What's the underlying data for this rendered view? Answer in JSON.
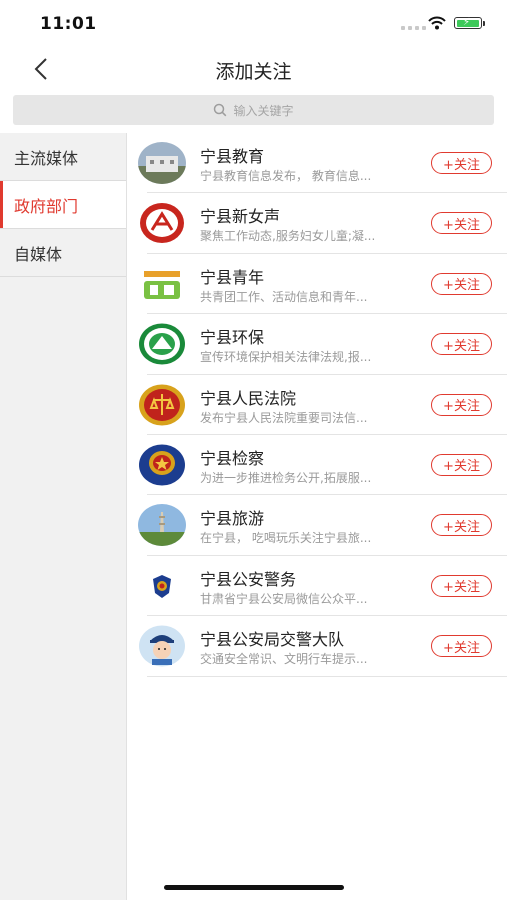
{
  "status_bar": {
    "time": "11:01"
  },
  "header": {
    "title": "添加关注",
    "back_icon": "chevron-left-icon"
  },
  "search": {
    "placeholder": "输入关键字",
    "icon": "search-icon"
  },
  "sidebar": {
    "items": [
      {
        "label": "主流媒体",
        "active": false
      },
      {
        "label": "政府部门",
        "active": true
      },
      {
        "label": "自媒体",
        "active": false
      }
    ]
  },
  "accounts": [
    {
      "name": "宁县教育",
      "desc": "宁县教育信息发布， 教育信息...",
      "follow": "+关注",
      "icon": "school-photo-icon"
    },
    {
      "name": "宁县新女声",
      "desc": "聚焦工作动态,服务妇女儿童;凝...",
      "follow": "+关注",
      "icon": "women-federation-icon"
    },
    {
      "name": "宁县青年",
      "desc": "共青团工作、活动信息和青年...",
      "follow": "+关注",
      "icon": "youth-logo-icon"
    },
    {
      "name": "宁县环保",
      "desc": "宣传环境保护相关法律法规,报...",
      "follow": "+关注",
      "icon": "environment-emblem-icon"
    },
    {
      "name": "宁县人民法院",
      "desc": "发布宁县人民法院重要司法信...",
      "follow": "+关注",
      "icon": "court-emblem-icon"
    },
    {
      "name": "宁县检察",
      "desc": "为进一步推进检务公开,拓展服...",
      "follow": "+关注",
      "icon": "procuratorate-emblem-icon"
    },
    {
      "name": "宁县旅游",
      "desc": "在宁县， 吃喝玩乐关注宁县旅...",
      "follow": "+关注",
      "icon": "tower-photo-icon"
    },
    {
      "name": "宁县公安警务",
      "desc": "甘肃省宁县公安局微信公众平...",
      "follow": "+关注",
      "icon": "police-badge-icon"
    },
    {
      "name": "宁县公安局交警大队",
      "desc": "交通安全常识、文明行车提示...",
      "follow": "+关注",
      "icon": "traffic-police-cartoon-icon"
    }
  ],
  "colors": {
    "accent": "#e03a2f",
    "sidebar_bg": "#f1f1f1",
    "search_bg": "#e6e6e6"
  }
}
